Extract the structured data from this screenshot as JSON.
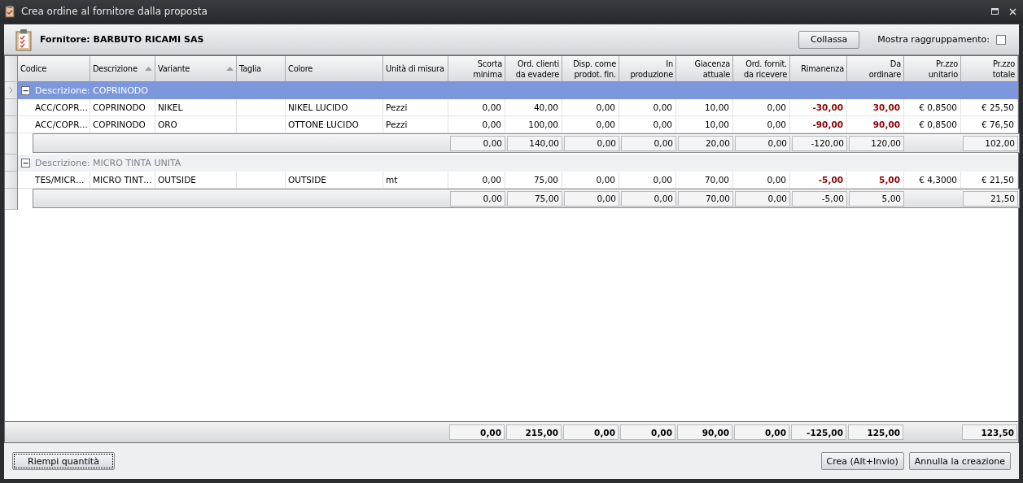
{
  "window": {
    "title": "Crea ordine al fornitore dalla proposta"
  },
  "header": {
    "supplier": "Fornitore: BARBUTO RICAMI SAS",
    "collapse_button": "Collassa",
    "grouping": {
      "label": "Mostra raggruppamento:",
      "checked": false
    }
  },
  "table": {
    "columns": [
      {
        "label": "Codice",
        "kind": "text",
        "sorted": false
      },
      {
        "label": "Descrizione",
        "kind": "text",
        "sorted": true
      },
      {
        "label": "Variante",
        "kind": "text",
        "sorted": true
      },
      {
        "label": "Taglia",
        "kind": "text",
        "sorted": false
      },
      {
        "label": "Colore",
        "kind": "text",
        "sorted": false
      },
      {
        "label": "Unità di misura",
        "kind": "text",
        "sorted": false
      },
      {
        "label": "Scorta\nminima",
        "kind": "number",
        "sorted": false
      },
      {
        "label": "Ord. clienti\nda evadere",
        "kind": "number",
        "sorted": false
      },
      {
        "label": "Disp. come\nprodot. fin.",
        "kind": "number",
        "sorted": false
      },
      {
        "label": "In\nproduzione",
        "kind": "number",
        "sorted": false
      },
      {
        "label": "Giacenza\nattuale",
        "kind": "number",
        "sorted": false
      },
      {
        "label": "Ord. fornit.\nda ricevere",
        "kind": "number",
        "sorted": false
      },
      {
        "label": "Rimanenza",
        "kind": "alert",
        "sorted": false
      },
      {
        "label": "Da\nordinare",
        "kind": "alert",
        "sorted": false
      },
      {
        "label": "Pr.zzo\nunitario",
        "kind": "number",
        "sorted": false
      },
      {
        "label": "Pr.zzo\ntotale",
        "kind": "number",
        "sorted": false
      }
    ],
    "groups": [
      {
        "label": "Descrizione: COPRINODO",
        "selected": true,
        "expanded": true,
        "rows": [
          {
            "code": "ACC/COPR…",
            "description": "COPRINODO",
            "variant": "NIKEL",
            "colore": "NIKEL LUCIDO",
            "unit": "Pezzi",
            "quantities": [
              "0,00",
              "40,00",
              "0,00",
              "0,00",
              "10,00",
              "0,00",
              "-30,00",
              "30,00"
            ],
            "unit_price": "€ 0,8500",
            "total_price": "€ 25,50"
          },
          {
            "code": "ACC/COPR…",
            "description": "COPRINODO",
            "variant": "ORO",
            "colore": "OTTONE LUCIDO",
            "unit": "Pezzi",
            "quantities": [
              "0,00",
              "100,00",
              "0,00",
              "0,00",
              "10,00",
              "0,00",
              "-90,00",
              "90,00"
            ],
            "unit_price": "€ 0,8500",
            "total_price": "€ 76,50"
          }
        ],
        "totals": {
          "quantities": [
            "0,00",
            "140,00",
            "0,00",
            "0,00",
            "20,00",
            "0,00",
            "-120,00",
            "120,00"
          ],
          "total_price": "102,00"
        }
      },
      {
        "label": "Descrizione: MICRO TINTA UNITA",
        "selected": false,
        "expanded": true,
        "rows": [
          {
            "code": "TES/MICR…",
            "description": "MICRO TINT…",
            "variant": "OUTSIDE",
            "colore": "OUTSIDE",
            "unit": "mt",
            "quantities": [
              "0,00",
              "75,00",
              "0,00",
              "0,00",
              "70,00",
              "0,00",
              "-5,00",
              "5,00"
            ],
            "unit_price": "€ 4,3000",
            "total_price": "€ 21,50"
          }
        ],
        "totals": {
          "quantities": [
            "0,00",
            "75,00",
            "0,00",
            "0,00",
            "70,00",
            "0,00",
            "-5,00",
            "5,00"
          ],
          "total_price": "21,50"
        }
      }
    ],
    "grand_totals": {
      "quantities": [
        "0,00",
        "215,00",
        "0,00",
        "0,00",
        "90,00",
        "0,00",
        "-125,00",
        "125,00"
      ],
      "total_price": "123,50"
    }
  },
  "buttons": {
    "fill": "Riempi quantità",
    "create": "Crea (Alt+Invio)",
    "cancel": "Annulla la creazione"
  }
}
